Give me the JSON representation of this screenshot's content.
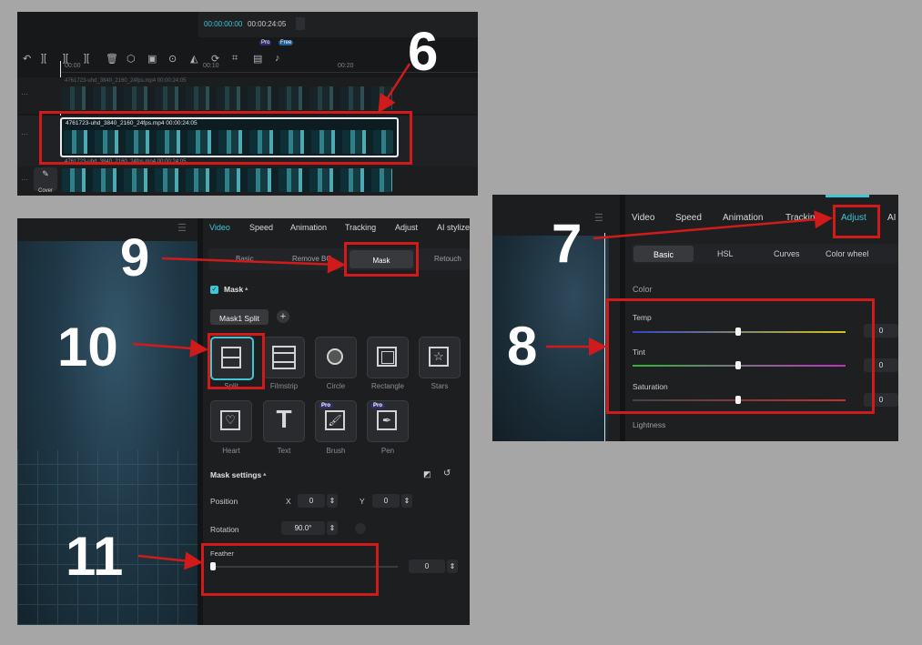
{
  "timeline": {
    "current_time": "00:00:00:00",
    "total_time": "00:00:24:05",
    "pro_badge": "Pro",
    "free_badge": "Free",
    "ruler": [
      "00:00",
      "00:10",
      "00:20"
    ],
    "clip_top_label": "4761723-uhd_3840_2160_24fps.mp4  00:00:24:05",
    "clip_main_label": "4761723-uhd_3840_2160_24fps.mp4   00:00:24:05",
    "clip_bottom_label": "4761723-uhd_3840_2160_24fps.mp4  00:00:24:05",
    "cover_label": "Cover"
  },
  "mask_panel": {
    "tabs": [
      "Video",
      "Speed",
      "Animation",
      "Tracking",
      "Adjust",
      "AI stylize"
    ],
    "subtabs": [
      "Basic",
      "Remove BG",
      "Mask",
      "Retouch"
    ],
    "mask_header": "Mask",
    "mask_chip": "Mask1 Split",
    "shapes": [
      {
        "label": "Split",
        "icon": "split-icon"
      },
      {
        "label": "Filmstrip",
        "icon": "filmstrip-icon"
      },
      {
        "label": "Circle",
        "icon": "circle-icon"
      },
      {
        "label": "Rectangle",
        "icon": "rectangle-icon"
      },
      {
        "label": "Stars",
        "icon": "star-icon"
      },
      {
        "label": "Heart",
        "icon": "heart-icon"
      },
      {
        "label": "Text",
        "icon": "text-icon"
      },
      {
        "label": "Brush",
        "icon": "brush-icon",
        "badge": "Pro"
      },
      {
        "label": "Pen",
        "icon": "pen-icon",
        "badge": "Pro"
      }
    ],
    "settings_header": "Mask settings",
    "position_label": "Position",
    "x_label": "X",
    "x_value": "0",
    "y_label": "Y",
    "y_value": "0",
    "rotation_label": "Rotation",
    "rotation_value": "90.0°",
    "feather_label": "Feather",
    "feather_value": "0"
  },
  "adjust_panel": {
    "tabs": [
      "Video",
      "Speed",
      "Animation",
      "Tracking",
      "Adjust",
      "AI"
    ],
    "subtabs": [
      "Basic",
      "HSL",
      "Curves",
      "Color wheel"
    ],
    "color_header": "Color",
    "sliders": [
      {
        "label": "Temp",
        "value": "0"
      },
      {
        "label": "Tint",
        "value": "0"
      },
      {
        "label": "Saturation",
        "value": "0"
      }
    ],
    "lightness_label": "Lightness"
  },
  "annotations": [
    "6",
    "7",
    "8",
    "9",
    "10",
    "11"
  ],
  "colors": {
    "accent": "#3fc6d6",
    "annotation_red": "#d11b1b",
    "panel_bg": "#1b1c1e"
  }
}
